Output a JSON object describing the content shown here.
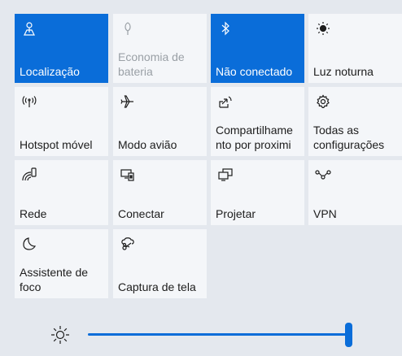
{
  "tiles": [
    {
      "label": "Localização",
      "icon": "location-icon",
      "state": "active"
    },
    {
      "label": "Economia de\nbateria",
      "icon": "battery-saver-icon",
      "state": "disabled"
    },
    {
      "label": "Não conectado",
      "icon": "bluetooth-icon",
      "state": "active"
    },
    {
      "label": "Luz noturna",
      "icon": "night-light-icon",
      "state": "off"
    },
    {
      "label": "Hotspot móvel",
      "icon": "mobile-hotspot-icon",
      "state": "off"
    },
    {
      "label": "Modo avião",
      "icon": "airplane-icon",
      "state": "off"
    },
    {
      "label": "Compartilhame\nnto por proximi",
      "icon": "nearby-sharing-icon",
      "state": "off"
    },
    {
      "label": "Todas as\nconfigurações",
      "icon": "settings-gear-icon",
      "state": "off"
    },
    {
      "label": "Rede",
      "icon": "network-icon",
      "state": "off"
    },
    {
      "label": "Conectar",
      "icon": "connect-icon",
      "state": "off"
    },
    {
      "label": "Projetar",
      "icon": "project-icon",
      "state": "off"
    },
    {
      "label": "VPN",
      "icon": "vpn-icon",
      "state": "off"
    },
    {
      "label": "Assistente de\nfoco",
      "icon": "focus-assist-moon-icon",
      "state": "off"
    },
    {
      "label": "Captura de tela",
      "icon": "screen-snip-icon",
      "state": "off"
    }
  ],
  "brightness": {
    "icon": "brightness-sun-icon",
    "level": 1.0
  },
  "colors": {
    "accent": "#0a6dd9",
    "tile": "#f4f6f9",
    "background": "#e4e8ee"
  }
}
